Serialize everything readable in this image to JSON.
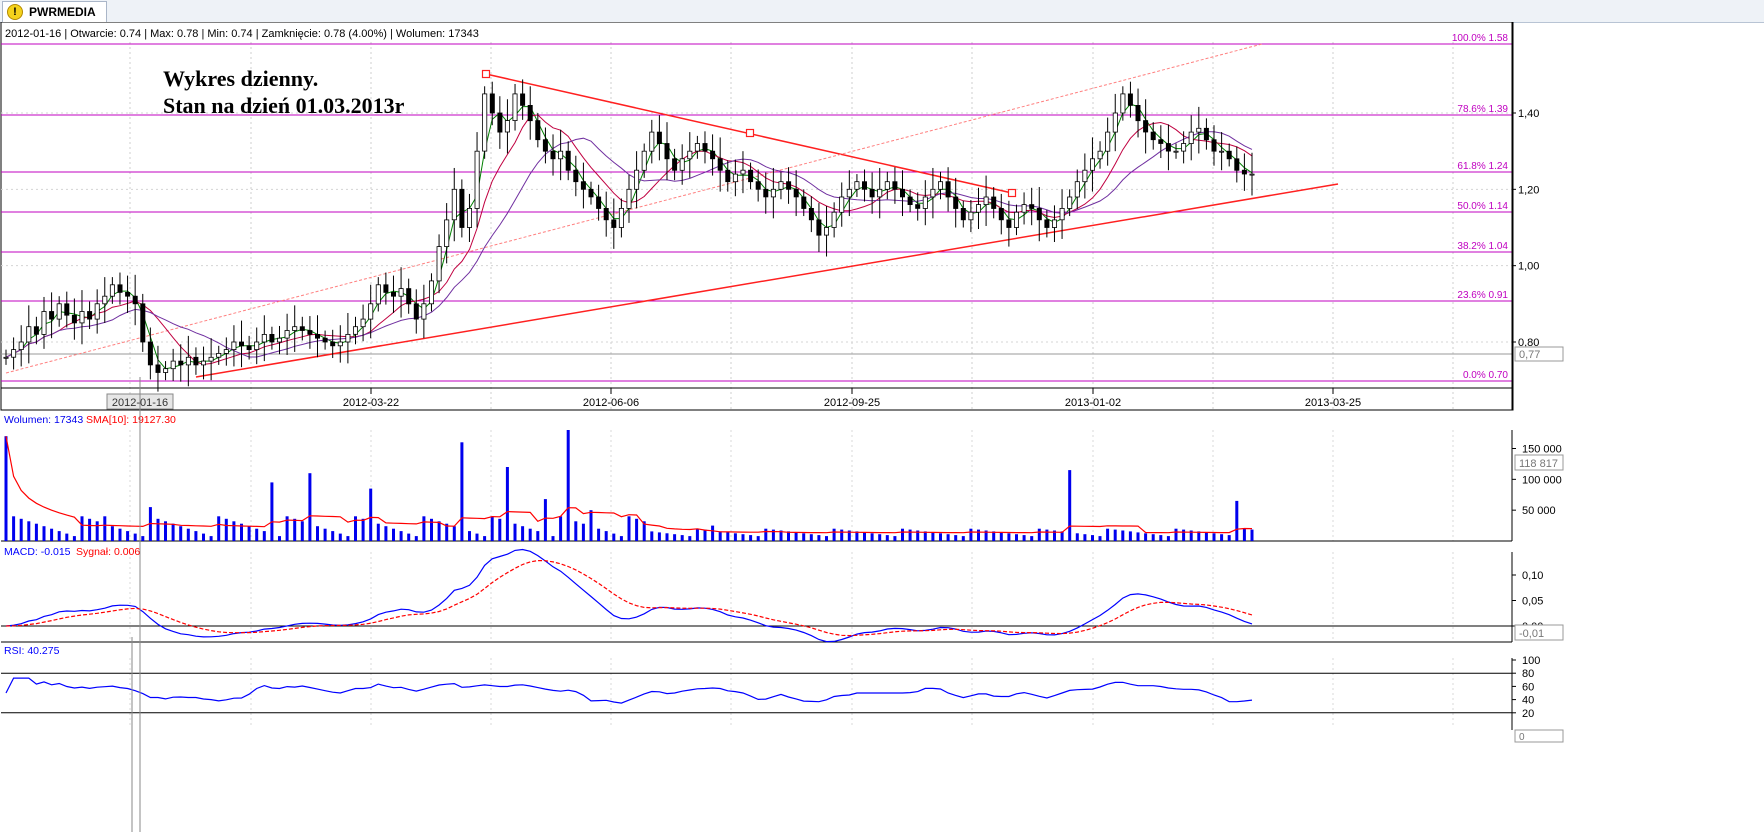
{
  "tab": {
    "title": "PWRMEDIA",
    "icon": "warning-icon"
  },
  "info_line": "2012-01-16 | Otwarcie: 0.74 | Max: 0.78 | Min: 0.74 | Zamknięcie: 0.78 (4.00%)  | Wolumen: 17343",
  "annotation": {
    "line1": "Wykres dzienny.",
    "line2": "Stan na dzień 01.03.2013r"
  },
  "colors": {
    "fib": "#c000c0",
    "trend": "#ff2020",
    "ma_short": "#008000",
    "ma_mid": "#c00040",
    "ma_long": "#7030a0",
    "volume": "#0000ee",
    "volume_sma": "#ff0000",
    "macd": "#0000ff",
    "signal": "#ff0000",
    "rsi": "#0000ff"
  },
  "chart_data": [
    {
      "type": "candlestick",
      "name": "price",
      "x_labels": [
        "2012-03-22",
        "2012-06-06",
        "2012-09-25",
        "2013-01-02",
        "2013-03-25"
      ],
      "cursor_label": "2012-01-16",
      "y_ticks": [
        "0,80",
        "1,00",
        "1,20",
        "1,40"
      ],
      "y_tick_values": [
        0.8,
        1.0,
        1.2,
        1.4
      ],
      "ylim": [
        0.69,
        1.6
      ],
      "current_price_label": "0,77",
      "current_price": 0.77,
      "fibonacci_levels": [
        {
          "label": "100.0% 1.58",
          "value": 1.58
        },
        {
          "label": "78.6% 1.39",
          "value": 1.39
        },
        {
          "label": "61.8% 1.24",
          "value": 1.24
        },
        {
          "label": "50.0% 1.14",
          "value": 1.14
        },
        {
          "label": "38.2% 1.04",
          "value": 1.04
        },
        {
          "label": "23.6% 0.91",
          "value": 0.91
        },
        {
          "label": "0.0% 0.70",
          "value": 0.7
        }
      ],
      "closes": [
        0.76,
        0.78,
        0.8,
        0.84,
        0.82,
        0.88,
        0.86,
        0.9,
        0.87,
        0.85,
        0.88,
        0.86,
        0.9,
        0.92,
        0.95,
        0.93,
        0.92,
        0.9,
        0.8,
        0.74,
        0.72,
        0.73,
        0.75,
        0.74,
        0.76,
        0.74,
        0.75,
        0.76,
        0.77,
        0.78,
        0.8,
        0.79,
        0.78,
        0.8,
        0.82,
        0.8,
        0.81,
        0.83,
        0.84,
        0.83,
        0.82,
        0.81,
        0.8,
        0.79,
        0.8,
        0.82,
        0.84,
        0.86,
        0.9,
        0.95,
        0.93,
        0.92,
        0.94,
        0.9,
        0.86,
        0.9,
        0.96,
        1.05,
        1.12,
        1.2,
        1.1,
        1.15,
        1.3,
        1.45,
        1.4,
        1.35,
        1.38,
        1.45,
        1.42,
        1.38,
        1.33,
        1.3,
        1.28,
        1.3,
        1.25,
        1.22,
        1.2,
        1.18,
        1.15,
        1.12,
        1.1,
        1.15,
        1.2,
        1.25,
        1.3,
        1.35,
        1.32,
        1.28,
        1.25,
        1.28,
        1.3,
        1.32,
        1.3,
        1.28,
        1.25,
        1.22,
        1.24,
        1.25,
        1.22,
        1.2,
        1.18,
        1.2,
        1.22,
        1.2,
        1.18,
        1.15,
        1.12,
        1.08,
        1.1,
        1.14,
        1.18,
        1.2,
        1.22,
        1.2,
        1.18,
        1.2,
        1.22,
        1.2,
        1.18,
        1.16,
        1.15,
        1.18,
        1.2,
        1.22,
        1.18,
        1.15,
        1.12,
        1.14,
        1.16,
        1.18,
        1.15,
        1.12,
        1.1,
        1.14,
        1.16,
        1.15,
        1.12,
        1.1,
        1.12,
        1.15,
        1.18,
        1.22,
        1.25,
        1.28,
        1.3,
        1.35,
        1.4,
        1.45,
        1.42,
        1.38,
        1.35,
        1.33,
        1.32,
        1.3,
        1.3,
        1.32,
        1.35,
        1.36,
        1.33,
        1.3,
        1.3,
        1.28,
        1.25,
        1.24,
        1.24
      ],
      "annotations": [
        {
          "type": "trendline",
          "from": [
            "2012-04-17",
            1.5
          ],
          "to": [
            "2012-11-28",
            1.19
          ]
        },
        {
          "type": "trendline",
          "from": [
            "2012-02-10",
            0.72
          ],
          "to": [
            "2013-03-25",
            1.21
          ]
        }
      ]
    },
    {
      "type": "bar",
      "name": "volume",
      "legend": "Wolumen: 17343",
      "sma_legend": "SMA[10]: 19127.30",
      "y_ticks": [
        "150 000",
        "100 000",
        "50 000"
      ],
      "y_tick_values": [
        150000,
        100000,
        50000
      ],
      "ylim": [
        0,
        180000
      ],
      "current_label": "118 817",
      "current_value": 118817
    },
    {
      "type": "line",
      "name": "macd",
      "legend": "MACD: -0.015",
      "signal_legend": "Sygnał: 0.006",
      "y_ticks": [
        "0,10",
        "0,05",
        "0,00"
      ],
      "y_tick_values": [
        0.1,
        0.05,
        0.0
      ],
      "ylim": [
        -0.03,
        0.14
      ],
      "current_label": "-0,01",
      "current_value": -0.01
    },
    {
      "type": "line",
      "name": "rsi",
      "legend": "RSI: 40.275",
      "y_ticks": [
        "100",
        "80",
        "60",
        "40",
        "20",
        "0"
      ],
      "y_tick_values": [
        100,
        80,
        60,
        40,
        20,
        0
      ],
      "ylim": [
        0,
        100
      ],
      "bottom_label": "0"
    }
  ]
}
